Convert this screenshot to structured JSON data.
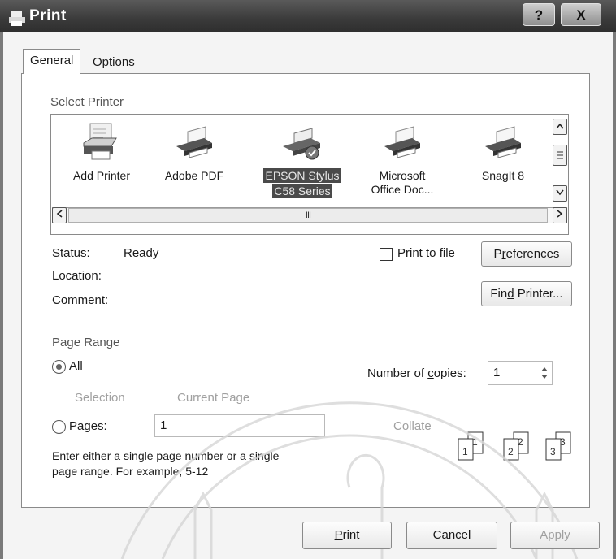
{
  "window": {
    "title": "Print",
    "help_glyph": "?",
    "close_glyph": "X"
  },
  "tabs": [
    {
      "label": "General",
      "active": true
    },
    {
      "label": "Options",
      "active": false
    }
  ],
  "select_printer": {
    "label": "Select Printer",
    "printers": [
      {
        "name_line1": "Add Printer",
        "name_line2": "",
        "icon": "add-printer-icon",
        "selected": false
      },
      {
        "name_line1": "Adobe PDF",
        "name_line2": "",
        "icon": "printer-icon",
        "selected": false
      },
      {
        "name_line1": "EPSON Stylus",
        "name_line2": "C58 Series",
        "icon": "default-printer-icon",
        "selected": true
      },
      {
        "name_line1": "Microsoft",
        "name_line2": "Office Doc...",
        "icon": "printer-icon",
        "selected": false
      },
      {
        "name_line1": "SnagIt 8",
        "name_line2": "",
        "icon": "printer-icon",
        "selected": false
      }
    ],
    "hscroll_thumb_text": "III"
  },
  "printer_info": {
    "status_label": "Status:",
    "status_value": "Ready",
    "location_label": "Location:",
    "comment_label": "Comment:",
    "print_to_file_pre": "Print to ",
    "print_to_file_key": "f",
    "print_to_file_post": "ile",
    "print_to_file_checked": false,
    "preferences_pre": "P",
    "preferences_key": "r",
    "preferences_post": "eferences",
    "find_printer_pre": "Fin",
    "find_printer_key": "d",
    "find_printer_post": " Printer..."
  },
  "page_range": {
    "label": "Page Range",
    "all_label": "All",
    "selection_label": "Selection",
    "current_page_label": "Current Page",
    "pages_label": "Pages:",
    "pages_value": "1",
    "help_line1": "Enter either a single page number or a single",
    "help_line2": "page range.  For example, 5-12",
    "selected": "all"
  },
  "copies": {
    "label_pre": "Number of ",
    "label_key": "c",
    "label_post": "opies:",
    "value": "1",
    "collate_label": "Collate",
    "collate_page_labels": [
      "1",
      "1",
      "2",
      "2",
      "3",
      "3"
    ]
  },
  "buttons": {
    "print_key": "P",
    "print_post": "rint",
    "cancel": "Cancel",
    "apply": "Apply"
  },
  "colors": {
    "selection": "#4a4a4a",
    "titlebar": "#3a3a3a"
  }
}
